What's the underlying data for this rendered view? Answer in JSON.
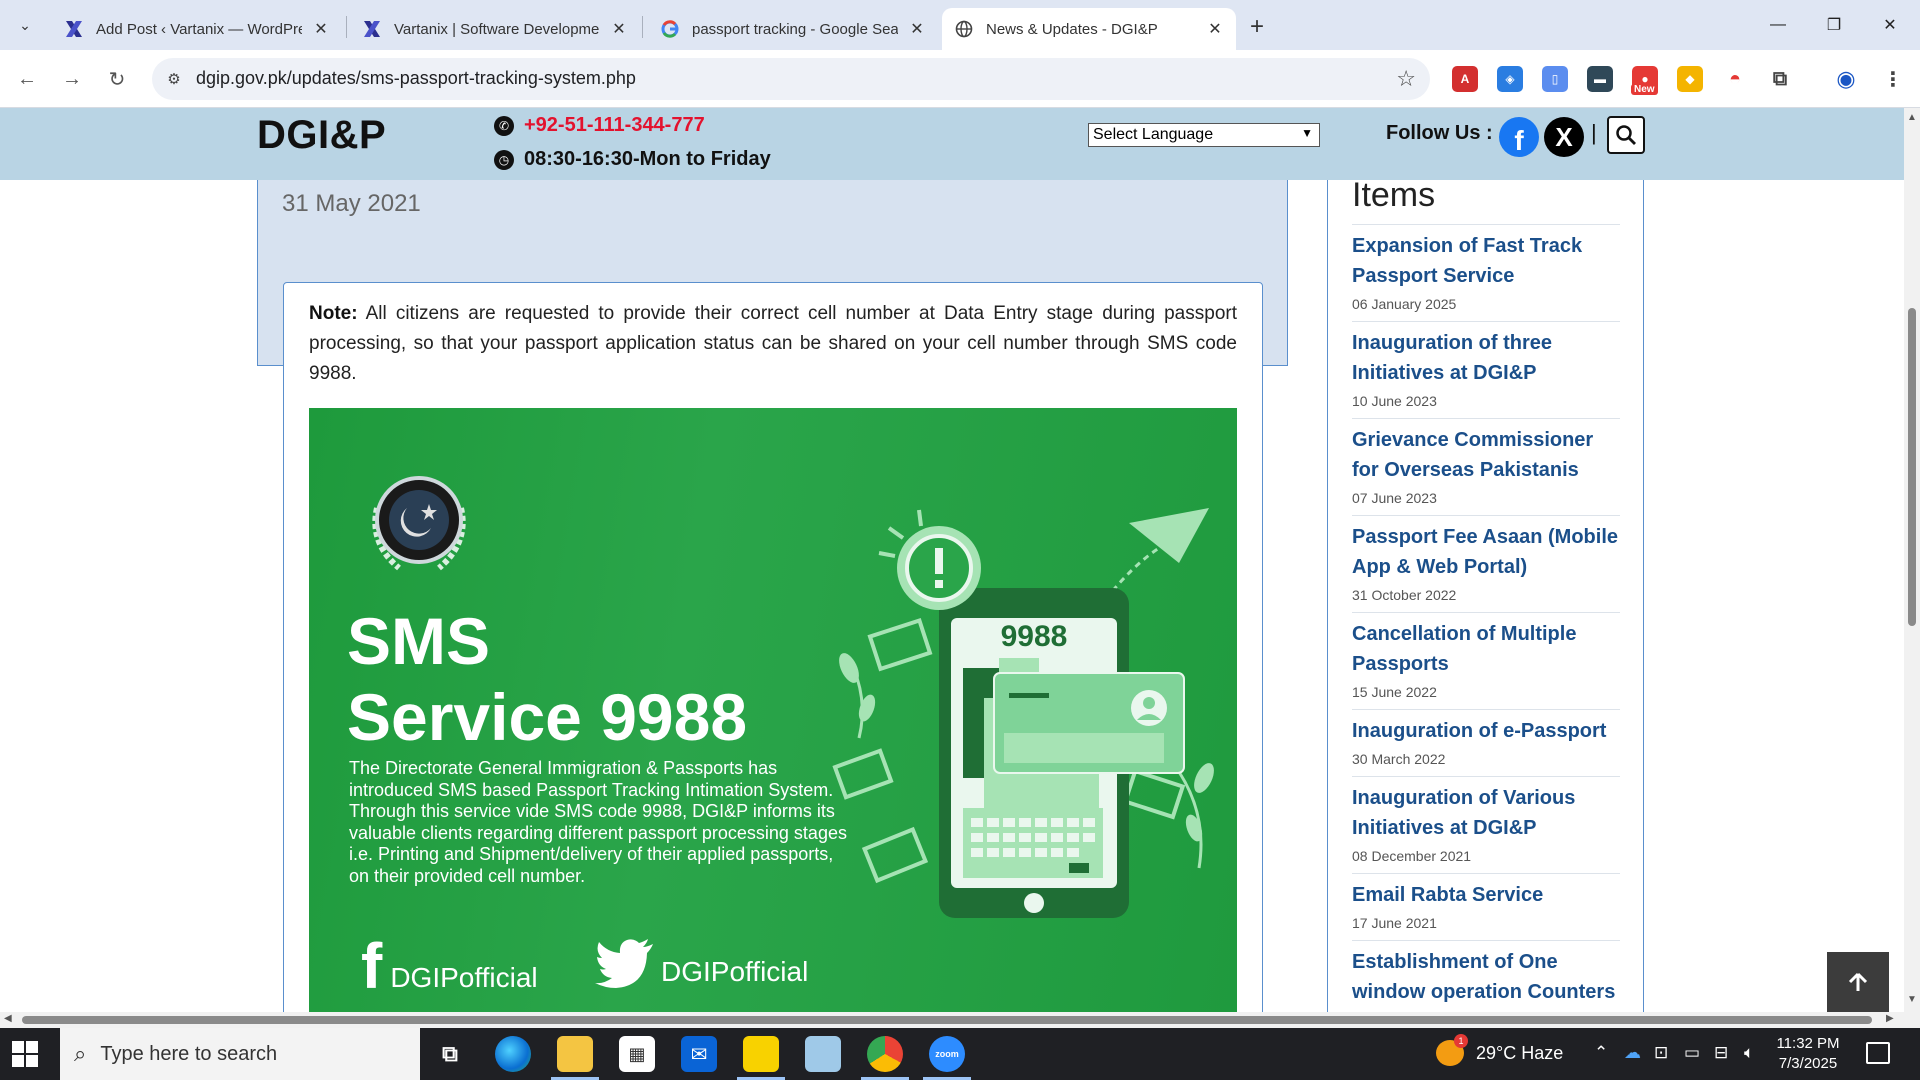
{
  "browser": {
    "tabs": [
      {
        "title": "Add Post ‹ Vartanix — WordPress",
        "icon": "vartanix-icon"
      },
      {
        "title": "Vartanix | Software Development",
        "icon": "vartanix-icon"
      },
      {
        "title": "passport tracking - Google Search",
        "icon": "google-icon"
      },
      {
        "title": "News & Updates - DGI&P",
        "icon": "globe-icon",
        "active": true
      }
    ],
    "url": "dgip.gov.pk/updates/sms-passport-tracking-system.php",
    "new_badge": "New"
  },
  "site": {
    "logo": "DGI&P",
    "phone": "+92-51-111-344-777",
    "hours": "08:30-16:30-Mon to Friday",
    "language_select": "Select Language",
    "follow_label": "Follow Us :",
    "separator": "|"
  },
  "article": {
    "date": "31 May 2021",
    "note_label": "Note:",
    "note_text": "All citizens are requested to provide their correct cell number at Data Entry stage during passport processing, so that your passport application status can be shared on your cell number through SMS code 9988."
  },
  "banner": {
    "title_line1": "SMS",
    "title_line2": "Service 9988",
    "description_1": "The Directorate General Immigration & Passports has introduced SMS based Passport Tracking Intimation System.",
    "description_2": "Through this service vide SMS code 9988, DGI&P informs its valuable clients regarding different passport processing stages i.e. Printing and Shipment/delivery of their applied passports, on their provided cell number.",
    "facebook_handle": "DGIPofficial",
    "twitter_handle": "DGIPofficial",
    "phone_code": "9988",
    "colors": {
      "green": "#1e9a3c",
      "light_green": "#a6e3b4"
    }
  },
  "sidebar": {
    "title": "Items",
    "items": [
      {
        "title": "Expansion of Fast Track Passport Service",
        "date": "06 January 2025"
      },
      {
        "title": "Inauguration of three Initiatives at DGI&P",
        "date": "10 June 2023"
      },
      {
        "title": "Grievance Commissioner for Overseas Pakistanis",
        "date": "07 June 2023"
      },
      {
        "title": "Passport Fee Asaan (Mobile App & Web Portal)",
        "date": "31 October 2022"
      },
      {
        "title": "Cancellation of Multiple Passports",
        "date": "15 June 2022"
      },
      {
        "title": "Inauguration of e-Passport",
        "date": "30 March 2022"
      },
      {
        "title": "Inauguration of Various Initiatives at DGI&P",
        "date": "08 December 2021"
      },
      {
        "title": "Email Rabta Service",
        "date": "17 June 2021"
      },
      {
        "title": "Establishment of One window operation Counters",
        "date": ""
      }
    ]
  },
  "taskbar": {
    "search_placeholder": "Type here to search",
    "weather": "29°C  Haze",
    "weather_badge": "1",
    "time": "11:32 PM",
    "date": "7/3/2025",
    "zoom_label": "zoom"
  }
}
